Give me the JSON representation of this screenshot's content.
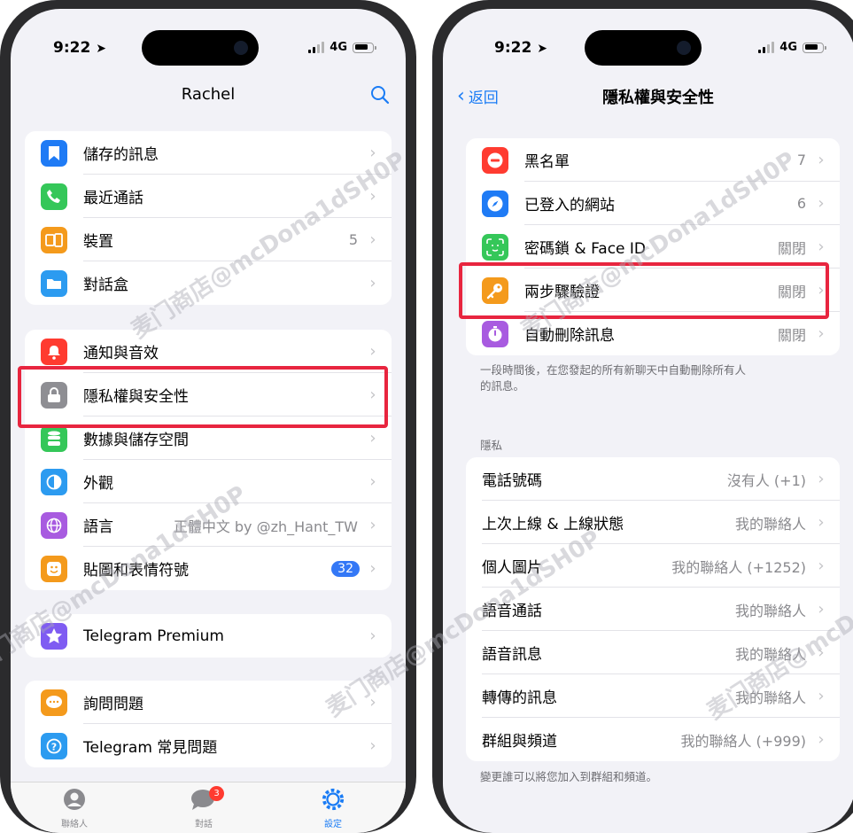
{
  "watermark": "麦门商店@mcDona1dSH0P",
  "left": {
    "status": {
      "time": "9:22",
      "network": "4G"
    },
    "title": "Rachel",
    "groups": [
      [
        {
          "label": "儲存的訊息",
          "value": "",
          "icon": "bookmark-icon",
          "color": "#1f7bf5"
        },
        {
          "label": "最近通話",
          "value": "",
          "icon": "phone-icon",
          "color": "#35c759"
        },
        {
          "label": "裝置",
          "value": "5",
          "icon": "devices-icon",
          "color": "#f49a1c"
        },
        {
          "label": "對話盒",
          "value": "",
          "icon": "folder-icon",
          "color": "#2c9bf0"
        }
      ],
      [
        {
          "label": "通知與音效",
          "value": "",
          "icon": "bell-icon",
          "color": "#ff3b30"
        },
        {
          "label": "隱私權與安全性",
          "value": "",
          "icon": "lock-icon",
          "color": "#8e8e93"
        },
        {
          "label": "數據與儲存空間",
          "value": "",
          "icon": "database-icon",
          "color": "#35c759"
        },
        {
          "label": "外觀",
          "value": "",
          "icon": "half-circle-icon",
          "color": "#2c9bf0"
        },
        {
          "label": "語言",
          "value": "正體中文 by @zh_Hant_TW",
          "icon": "globe-icon",
          "color": "#a85be0"
        },
        {
          "label": "貼圖和表情符號",
          "value": "",
          "badge": "32",
          "icon": "sticker-icon",
          "color": "#f49a1c"
        }
      ],
      [
        {
          "label": "Telegram Premium",
          "value": "",
          "icon": "star-icon",
          "color": "#7f5cf2"
        }
      ],
      [
        {
          "label": "詢問問題",
          "value": "",
          "icon": "chat-bubble-icon",
          "color": "#f49a1c"
        },
        {
          "label": "Telegram 常見問題",
          "value": "",
          "icon": "question-icon",
          "color": "#2c9bf0"
        }
      ]
    ],
    "tabs": [
      {
        "label": "聯絡人",
        "icon": "person-icon"
      },
      {
        "label": "對話",
        "icon": "chats-icon",
        "badge": "3"
      },
      {
        "label": "設定",
        "icon": "gear-icon"
      }
    ]
  },
  "right": {
    "status": {
      "time": "9:22",
      "network": "4G"
    },
    "back_label": "返回",
    "title": "隱私權與安全性",
    "security": [
      {
        "label": "黑名單",
        "value": "7",
        "icon": "block-icon",
        "color": "#ff3b30"
      },
      {
        "label": "已登入的網站",
        "value": "6",
        "icon": "compass-icon",
        "color": "#1f7bf5"
      },
      {
        "label": "密碼鎖 & Face ID",
        "value": "關閉",
        "icon": "faceid-icon",
        "color": "#35c759"
      },
      {
        "label": "兩步驟驗證",
        "value": "關閉",
        "icon": "key-icon",
        "color": "#f49a1c"
      },
      {
        "label": "自動刪除訊息",
        "value": "關閉",
        "icon": "timer-icon",
        "color": "#a85be0"
      }
    ],
    "auto_delete_note_1": "一段時間後，在您發起的所有新聊天中自動刪除所有人",
    "auto_delete_note_2": "的訊息。",
    "privacy_header": "隱私",
    "privacy": [
      {
        "label": "電話號碼",
        "value": "沒有人 (+1)"
      },
      {
        "label": "上次上線 & 上線狀態",
        "value": "我的聯絡人"
      },
      {
        "label": "個人圖片",
        "value": "我的聯絡人 (+1252)"
      },
      {
        "label": "語音通話",
        "value": "我的聯絡人"
      },
      {
        "label": "語音訊息",
        "value": "我的聯絡人"
      },
      {
        "label": "轉傳的訊息",
        "value": "我的聯絡人"
      },
      {
        "label": "群組與頻道",
        "value": "我的聯絡人 (+999)"
      }
    ],
    "groups_note": "變更誰可以將您加入到群組和頻道。"
  }
}
